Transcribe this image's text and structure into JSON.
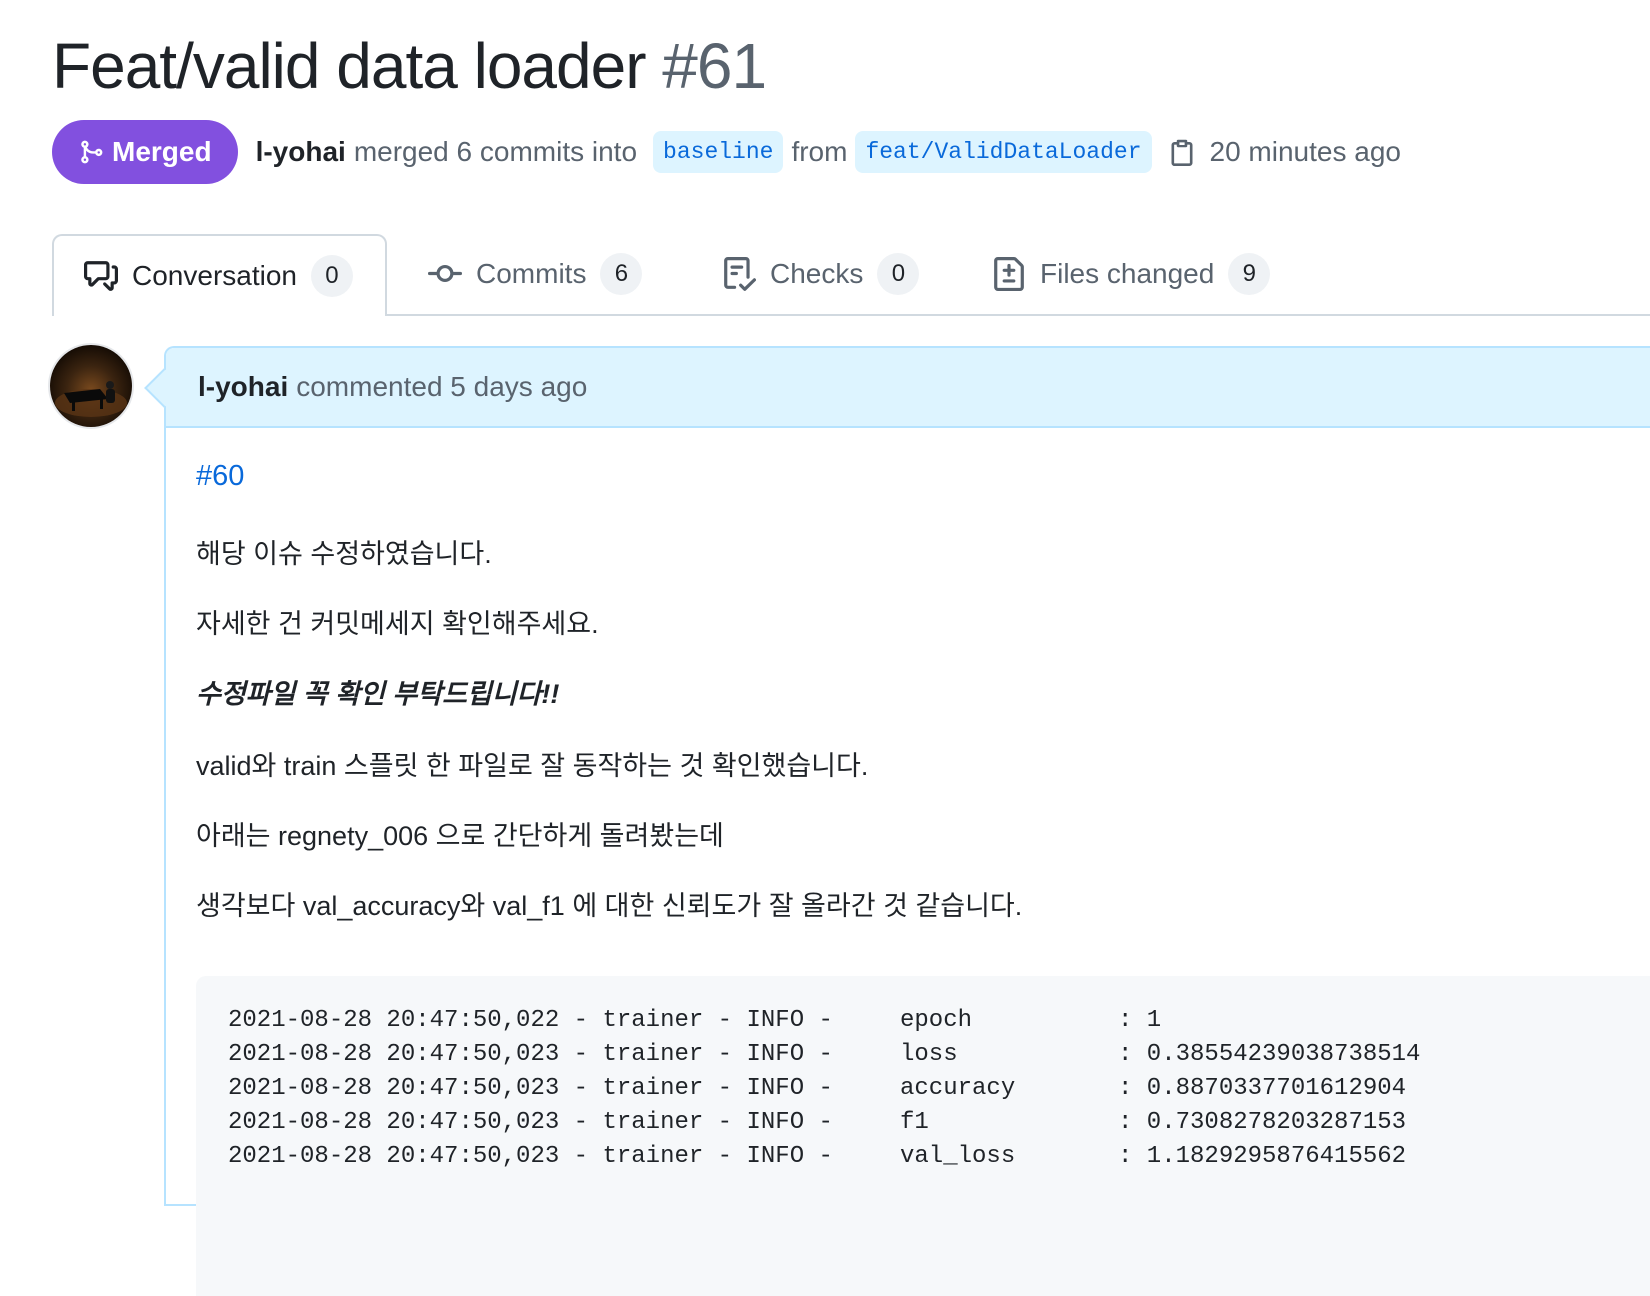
{
  "pr": {
    "title": "Feat/valid data loader",
    "number": "#61",
    "state_label": "Merged",
    "author": "l-yohai",
    "merged_text": "merged 6 commits into",
    "base_branch": "baseline",
    "from_text": "from",
    "head_branch": "feat/ValidDataLoader",
    "time": "20 minutes ago"
  },
  "tabs": [
    {
      "label": "Conversation",
      "count": "0",
      "icon": "comment-discussion-icon"
    },
    {
      "label": "Commits",
      "count": "6",
      "icon": "git-commit-icon"
    },
    {
      "label": "Checks",
      "count": "0",
      "icon": "checklist-icon"
    },
    {
      "label": "Files changed",
      "count": "9",
      "icon": "file-diff-icon"
    }
  ],
  "comment": {
    "author": "l-yohai",
    "meta": "commented 5 days ago",
    "issue_link": "#60",
    "paragraphs": [
      "해당 이슈 수정하였습니다.",
      "자세한 건 커밋메세지 확인해주세요.",
      "수정파일 꼭 확인 부탁드립니다!!",
      "valid와 train 스플릿 한 파일로 잘 동작하는 것 확인했습니다.",
      "아래는 regnety_006 으로 간단하게 돌려봤는데",
      "생각보다 val_accuracy와 val_f1 에 대한 신뢰도가 잘 올라간 것 같습니다."
    ],
    "code_lines": [
      {
        "prefix": "2021-08-28 20:47:50,022 - trainer - INFO -",
        "key": "epoch",
        "value": ": 1"
      },
      {
        "prefix": "2021-08-28 20:47:50,023 - trainer - INFO -",
        "key": "loss",
        "value": ": 0.38554239038738514"
      },
      {
        "prefix": "2021-08-28 20:47:50,023 - trainer - INFO -",
        "key": "accuracy",
        "value": ": 0.8870337701612904"
      },
      {
        "prefix": "2021-08-28 20:47:50,023 - trainer - INFO -",
        "key": "f1",
        "value": ": 0.7308278203287153"
      },
      {
        "prefix": "2021-08-28 20:47:50,023 - trainer - INFO -",
        "key": "val_loss",
        "value": ": 1.1829295876415562"
      }
    ]
  },
  "colors": {
    "merged": "#8250df",
    "link": "#0969da",
    "comment_header": "#ddf4ff"
  }
}
